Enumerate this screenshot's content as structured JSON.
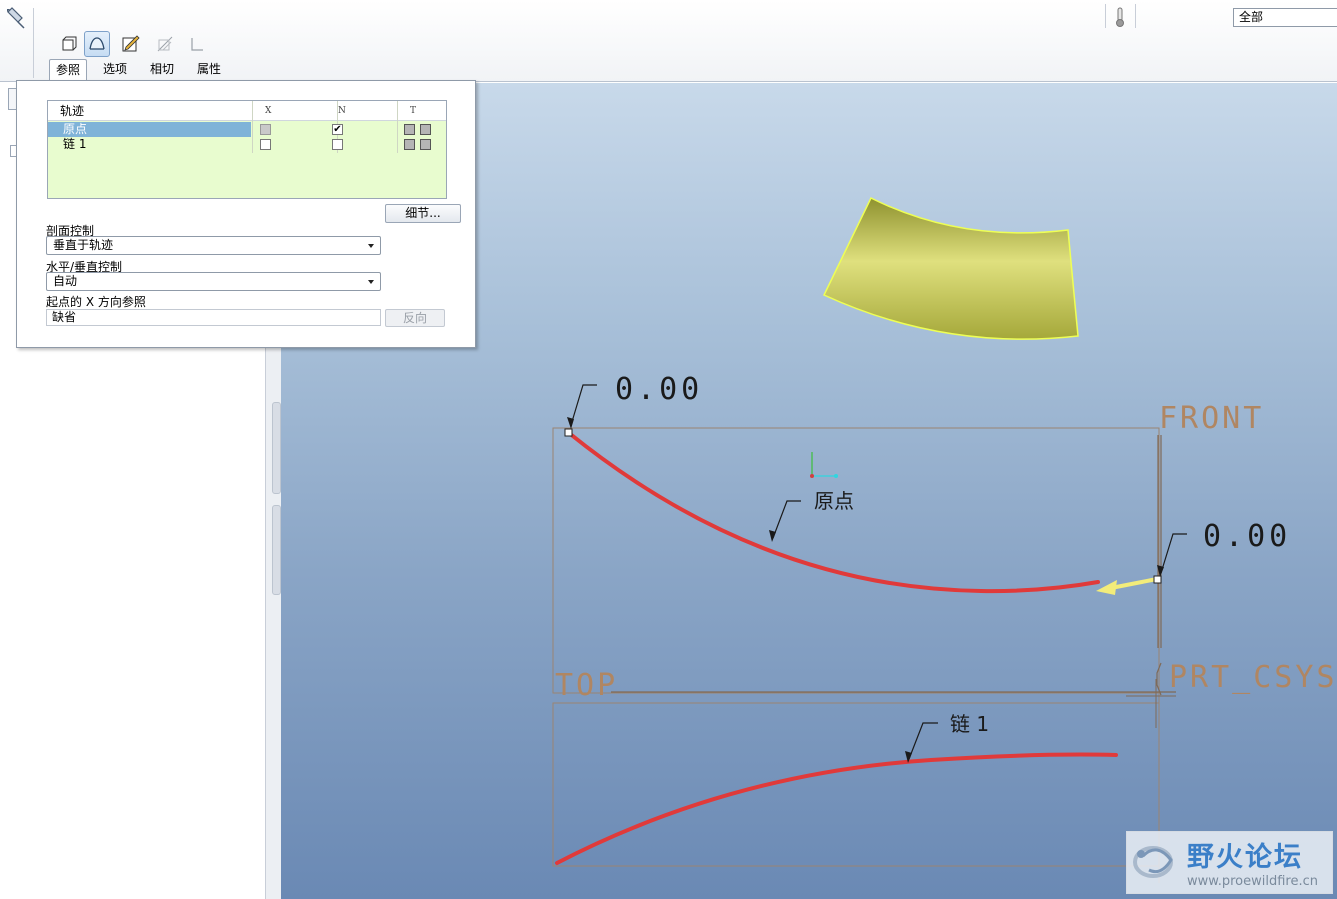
{
  "ribbon": {
    "tabs": [
      "参照",
      "选项",
      "相切",
      "属性"
    ],
    "filter_value": "全部"
  },
  "ref_panel": {
    "table": {
      "headers": [
        "轨迹",
        "X",
        "N",
        "T"
      ],
      "rows": [
        {
          "name": "原点",
          "x": "disabled",
          "n": true
        },
        {
          "name": "链 1",
          "x": false,
          "n": false
        }
      ]
    },
    "details_button": "细节...",
    "section_control_label": "剖面控制",
    "section_control_value": "垂直于轨迹",
    "hv_control_label": "水平/垂直控制",
    "hv_control_value": "自动",
    "xref_label": "起点的 X 方向参照",
    "xref_value": "缺省",
    "reverse_button": "反向"
  },
  "viewport": {
    "dim_top": "0.00",
    "dim_right": "0.00",
    "datum_front": "FRONT",
    "datum_top": "TOP",
    "datum_csys": "PRT_CSYS_",
    "label_origin": "原点",
    "label_chain": "链 1",
    "colors": {
      "trajectory": "#e03a3a",
      "surface": "#d6d86a",
      "datum": "#b08662",
      "start_arrow": "#f2ec7a"
    }
  },
  "watermark": {
    "title": "野火论坛",
    "url": "www.proewildfire.cn"
  }
}
